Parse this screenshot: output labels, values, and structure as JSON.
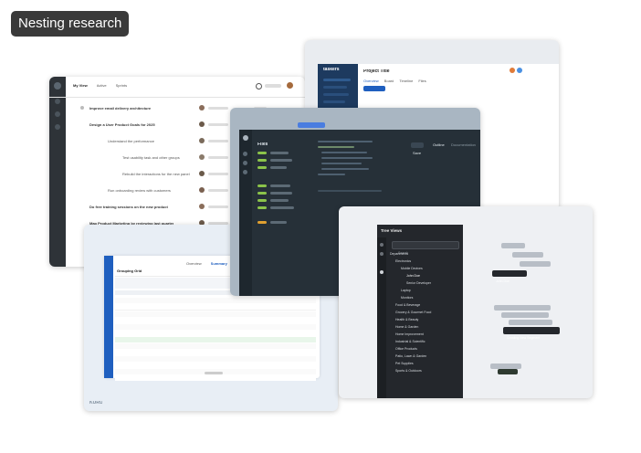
{
  "header": {
    "title": "Nesting research"
  },
  "card1": {
    "tabs": [
      "My View",
      "Active",
      "Sprints"
    ],
    "rows": [
      "Improve email delivery architecture",
      "Design a User Product Goals for 2025",
      "Understand the performance",
      "Test usability task and other groups",
      "Rebuild the interactions for the new panel",
      "Run onboarding review with customers",
      "Do free training sessions on the new product",
      "Map Product Marketing by reviewing last quarter"
    ]
  },
  "card2": {
    "app": "taskers",
    "project_title": "Project Title",
    "tabs": [
      "Overview",
      "Board",
      "Timeline",
      "Files"
    ],
    "button": "Add task"
  },
  "card3": {
    "sidebar_title": "Files",
    "tabs": [
      "Outline",
      "Documentation"
    ],
    "button": "Save"
  },
  "card4": {
    "title": "Grouping Grid",
    "tabs": [
      "Overview",
      "Summary",
      "Reports"
    ],
    "logo": "KURU"
  },
  "card5": {
    "panel_title": "Tree Views",
    "search_placeholder": "Search",
    "root": "Departments",
    "items": [
      "Electronics",
      "Mobile Devices",
      "John Doe",
      "Senior Developer",
      "Laptop",
      "Monitors",
      "Food & Beverage",
      "Grocery & Gourmet Food",
      "Health & Beauty",
      "Home & Garden",
      "Home Improvement",
      "Industrial & Scientific",
      "Office Products",
      "Patio, Lawn & Garden",
      "Pet Supplies",
      "Sports & Outdoors"
    ],
    "drag_labels": [
      "John Doe",
      "Creating New Segment"
    ]
  },
  "colors": {
    "pill_bg": "#3a3a3a",
    "dark_panel": "#263038",
    "tree_panel": "#24272c",
    "accent_blue": "#4a7de0",
    "accent_green": "#8bc34a"
  }
}
